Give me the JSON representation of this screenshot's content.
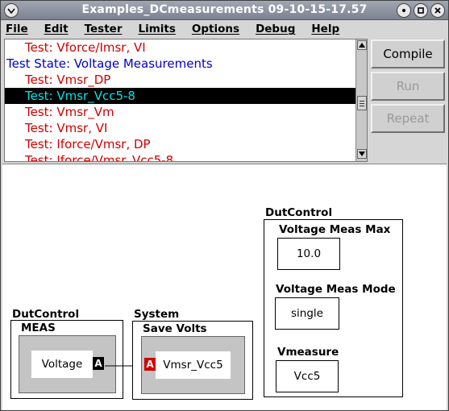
{
  "window": {
    "title": "Examples_DCmeasurements 09-10-15-17.57"
  },
  "menubar": {
    "items": [
      "File",
      "Edit",
      "Tester",
      "Limits",
      "Options",
      "Debug",
      "Help"
    ]
  },
  "test_list": {
    "items": [
      {
        "text": "Test: Vforce/Imsr, VI",
        "kind": "test"
      },
      {
        "text": "Test State: Voltage Measurements",
        "kind": "state"
      },
      {
        "text": "Test: Vmsr_DP",
        "kind": "test"
      },
      {
        "text": "Test: Vmsr_Vcc5-8",
        "kind": "test",
        "selected": true
      },
      {
        "text": "Test: Vmsr_Vm",
        "kind": "test"
      },
      {
        "text": "Test: Vmsr, VI",
        "kind": "test"
      },
      {
        "text": "Test: Iforce/Vmsr, DP",
        "kind": "test"
      },
      {
        "text": "Test: Iforce/Vmsr_Vcc5-8",
        "kind": "test"
      }
    ]
  },
  "buttons": {
    "compile": "Compile",
    "run": "Run",
    "repeat": "Repeat"
  },
  "canvas": {
    "dut_left": {
      "group_label": "DutControl",
      "block_label": "MEAS",
      "cell_text": "Voltage",
      "port_label": "A"
    },
    "system": {
      "group_label": "System",
      "block_label": "Save  Volts",
      "cell_text": "Vmsr_Vcc5",
      "port_label": "A"
    },
    "dut_right": {
      "group_label": "DutControl",
      "params": [
        {
          "label": "Voltage Meas Max",
          "value": "10.0"
        },
        {
          "label": "Voltage Meas Mode",
          "value": "single"
        },
        {
          "label": "Vmeasure",
          "value": "Vcc5"
        }
      ]
    }
  },
  "colors": {
    "test_text": "#d00000",
    "state_text": "#0000c8",
    "selected_bg": "#000000",
    "selected_text": "#00e5e5",
    "port_output": "#000000",
    "port_input": "#d00000"
  }
}
